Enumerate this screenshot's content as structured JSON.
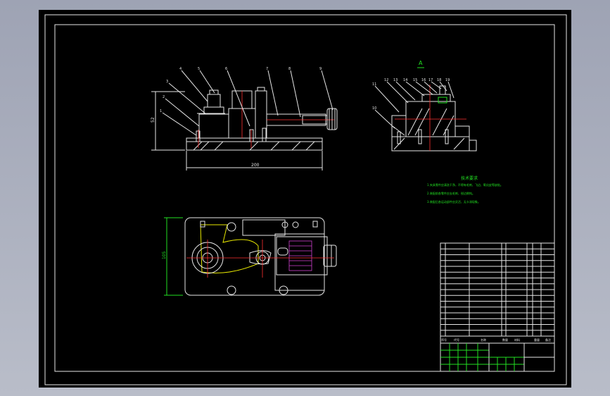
{
  "view_label": "A",
  "dims": {
    "height": "52",
    "length": "200",
    "plan_height": "105"
  },
  "front_balloons": [
    "4",
    "5",
    "6",
    "7",
    "8",
    "9",
    "3",
    "2",
    "1"
  ],
  "side_balloons": [
    "11",
    "12",
    "13",
    "14",
    "15",
    "16",
    "17",
    "18",
    "19",
    "10"
  ],
  "tech_title": "技术要求",
  "tech_lines": [
    "1.夹具零件应清洗干净，不得有毛刺、飞边、氧化皮等缺陷。",
    "2.装配前各零件应去毛刺、锐边倒钝。",
    "3.装配后各运动部件应灵活、无卡滞现象。"
  ],
  "table_headers": {
    "seq": "序号",
    "code": "代号",
    "name": "名称",
    "qty": "数量",
    "material": "材料",
    "weight": "重量",
    "note": "备注"
  }
}
